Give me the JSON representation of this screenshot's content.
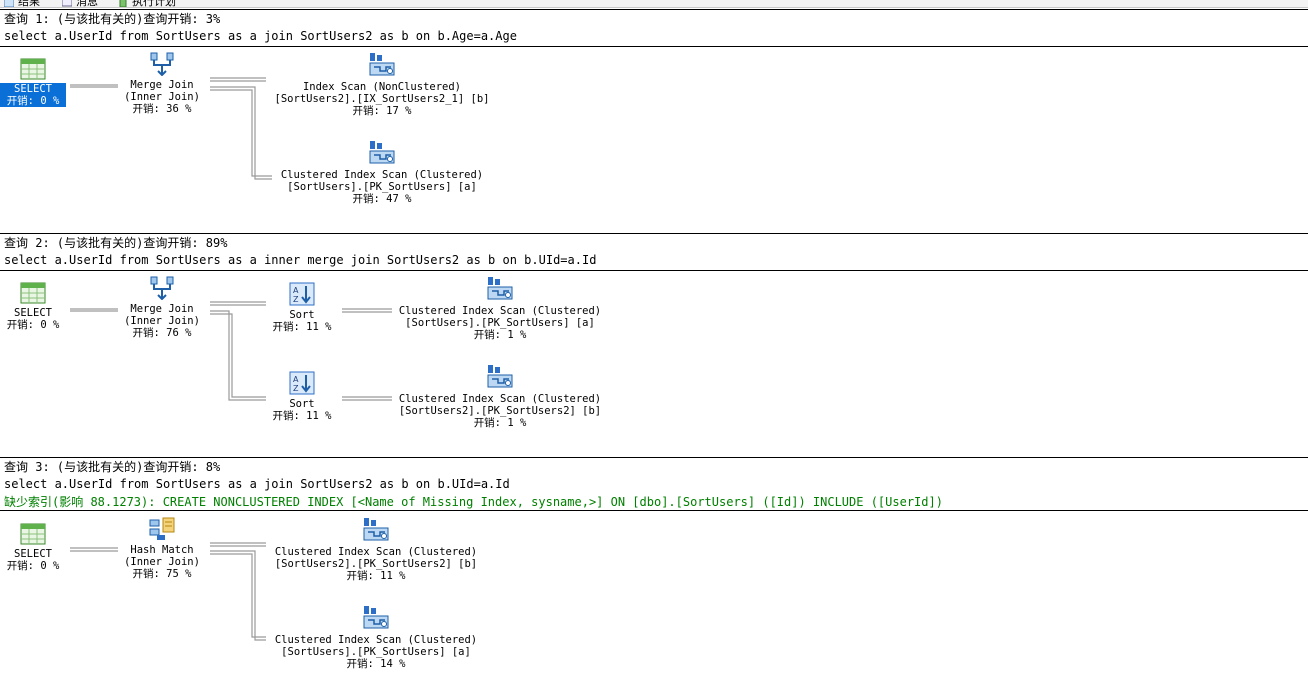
{
  "tabs": [
    {
      "label": "结果",
      "icon": "grid-icon"
    },
    {
      "label": "消息",
      "icon": "message-icon"
    },
    {
      "label": "执行计划",
      "icon": "execution-plan-icon"
    }
  ],
  "queries": [
    {
      "header": "查询 1: (与该批有关的)查询开销: 3%",
      "sql": "select a.UserId from SortUsers as a join SortUsers2 as b on b.Age=a.Age",
      "nodes": {
        "select": {
          "line1": "SELECT",
          "line2": "开销: 0 %"
        },
        "join": {
          "line1": "Merge Join",
          "line2": "(Inner Join)",
          "line3": "开销: 36 %"
        },
        "scan_top": {
          "line1": "Index Scan (NonClustered)",
          "line2": "[SortUsers2].[IX_SortUsers2_1] [b]",
          "line3": "开销: 17 %"
        },
        "scan_bottom": {
          "line1": "Clustered Index Scan (Clustered)",
          "line2": "[SortUsers].[PK_SortUsers] [a]",
          "line3": "开销: 47 %"
        }
      }
    },
    {
      "header": "查询 2: (与该批有关的)查询开销: 89%",
      "sql": "select a.UserId from SortUsers as a inner merge join SortUsers2 as b on b.UId=a.Id",
      "nodes": {
        "select": {
          "line1": "SELECT",
          "line2": "开销: 0 %"
        },
        "join": {
          "line1": "Merge Join",
          "line2": "(Inner Join)",
          "line3": "开销: 76 %"
        },
        "sort_top": {
          "line1": "Sort",
          "line2": "开销: 11 %"
        },
        "sort_bottom": {
          "line1": "Sort",
          "line2": "开销: 11 %"
        },
        "scan_top": {
          "line1": "Clustered Index Scan (Clustered)",
          "line2": "[SortUsers].[PK_SortUsers] [a]",
          "line3": "开销: 1 %"
        },
        "scan_bottom": {
          "line1": "Clustered Index Scan (Clustered)",
          "line2": "[SortUsers2].[PK_SortUsers2] [b]",
          "line3": "开销: 1 %"
        }
      }
    },
    {
      "header": "查询 3: (与该批有关的)查询开销: 8%",
      "sql": "select a.UserId from SortUsers as a join SortUsers2 as b on b.UId=a.Id",
      "missing_index": "缺少索引(影响 88.1273): CREATE NONCLUSTERED INDEX [<Name of Missing Index, sysname,>] ON [dbo].[SortUsers] ([Id]) INCLUDE ([UserId])",
      "nodes": {
        "select": {
          "line1": "SELECT",
          "line2": "开销: 0 %"
        },
        "join": {
          "line1": "Hash Match",
          "line2": "(Inner Join)",
          "line3": "开销: 75 %"
        },
        "scan_top": {
          "line1": "Clustered Index Scan (Clustered)",
          "line2": "[SortUsers2].[PK_SortUsers2] [b]",
          "line3": "开销: 11 %"
        },
        "scan_bottom": {
          "line1": "Clustered Index Scan (Clustered)",
          "line2": "[SortUsers].[PK_SortUsers] [a]",
          "line3": "开销: 14 %"
        }
      }
    }
  ],
  "colors": {
    "selection": "#0a6fd6",
    "missing_index_text": "#008000",
    "arrow": "#a0a0a0"
  }
}
